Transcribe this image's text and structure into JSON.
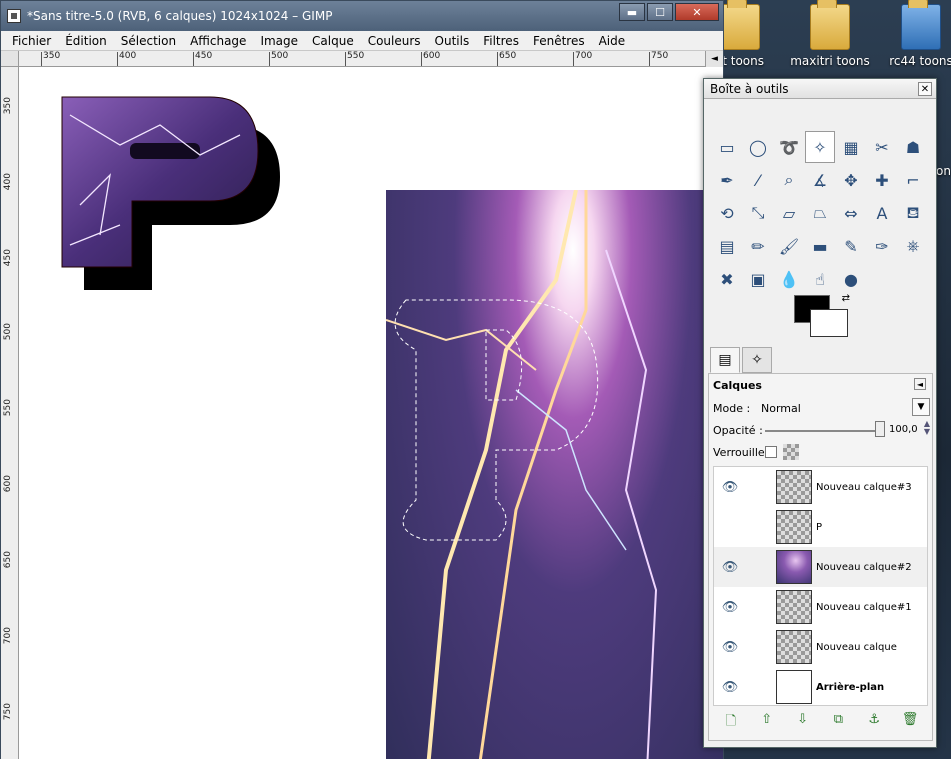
{
  "window": {
    "title": "*Sans titre-5.0 (RVB, 6 calques) 1024x1024 – GIMP",
    "minimize": "▬",
    "maximize": "☐",
    "close": "✕"
  },
  "menu": [
    "Fichier",
    "Édition",
    "Sélection",
    "Affichage",
    "Image",
    "Calque",
    "Couleurs",
    "Outils",
    "Filtres",
    "Fenêtres",
    "Aide"
  ],
  "ruler_top": [
    "350",
    "400",
    "450",
    "500",
    "550",
    "600",
    "650",
    "700",
    "750"
  ],
  "ruler_left": [
    "350",
    "400",
    "450",
    "500",
    "550",
    "600",
    "650",
    "700",
    "750"
  ],
  "desktop_icons": [
    {
      "label": "st toons",
      "color": "yellow"
    },
    {
      "label": "maxitri toons",
      "color": "yellow"
    },
    {
      "label": "rc44 toons",
      "color": "blue"
    }
  ],
  "desktop_extra": "on",
  "toolbox": {
    "title": "Boîte à outils",
    "close": "✕",
    "tools": [
      {
        "name": "rect-select-icon",
        "glyph": "▭"
      },
      {
        "name": "ellipse-select-icon",
        "glyph": "◯"
      },
      {
        "name": "lasso-icon",
        "glyph": "➰"
      },
      {
        "name": "fuzzy-select-icon",
        "glyph": "✧"
      },
      {
        "name": "color-select-icon",
        "glyph": "▦"
      },
      {
        "name": "scissors-icon",
        "glyph": "✂"
      },
      {
        "name": "foreground-select-icon",
        "glyph": "☗"
      },
      {
        "name": "paths-icon",
        "glyph": "✒"
      },
      {
        "name": "color-picker-icon",
        "glyph": "⁄"
      },
      {
        "name": "zoom-icon",
        "glyph": "⌕"
      },
      {
        "name": "measure-icon",
        "glyph": "∡"
      },
      {
        "name": "move-icon",
        "glyph": "✥"
      },
      {
        "name": "align-icon",
        "glyph": "✚"
      },
      {
        "name": "crop-icon",
        "glyph": "⌐"
      },
      {
        "name": "rotate-icon",
        "glyph": "⟲"
      },
      {
        "name": "scale-icon",
        "glyph": "⤡"
      },
      {
        "name": "shear-icon",
        "glyph": "▱"
      },
      {
        "name": "perspective-icon",
        "glyph": "⏢"
      },
      {
        "name": "flip-icon",
        "glyph": "⇔"
      },
      {
        "name": "text-icon",
        "glyph": "A"
      },
      {
        "name": "bucket-fill-icon",
        "glyph": "⛾"
      },
      {
        "name": "blend-icon",
        "glyph": "▤"
      },
      {
        "name": "pencil-icon",
        "glyph": "✏"
      },
      {
        "name": "paintbrush-icon",
        "glyph": "🖌"
      },
      {
        "name": "eraser-icon",
        "glyph": "▬"
      },
      {
        "name": "airbrush-icon",
        "glyph": "✎"
      },
      {
        "name": "ink-icon",
        "glyph": "✑"
      },
      {
        "name": "clone-icon",
        "glyph": "⎈"
      },
      {
        "name": "heal-icon",
        "glyph": "✖"
      },
      {
        "name": "perspective-clone-icon",
        "glyph": "▣"
      },
      {
        "name": "blur-icon",
        "glyph": "💧"
      },
      {
        "name": "smudge-icon",
        "glyph": "☝"
      },
      {
        "name": "dodge-burn-icon",
        "glyph": "●"
      }
    ],
    "fg_color": "#000000",
    "bg_color": "#ffffff"
  },
  "layers_panel": {
    "title": "Calques",
    "mode_label": "Mode :",
    "mode_value": "Normal",
    "opacity_label": "Opacité :",
    "opacity_value": "100,0",
    "lock_label": "Verrouiller :",
    "layers": [
      {
        "name": "Nouveau calque#3",
        "visible": true,
        "thumb": "checker",
        "bold": false
      },
      {
        "name": "P",
        "visible": false,
        "thumb": "checker",
        "bold": false
      },
      {
        "name": "Nouveau calque#2",
        "visible": true,
        "thumb": "purple",
        "bold": false,
        "selected": true
      },
      {
        "name": "Nouveau calque#1",
        "visible": true,
        "thumb": "checker",
        "bold": false
      },
      {
        "name": "Nouveau calque",
        "visible": true,
        "thumb": "checker",
        "bold": false
      },
      {
        "name": "Arrière-plan",
        "visible": true,
        "thumb": "white",
        "bold": true
      }
    ],
    "buttons": [
      "new-layer-icon",
      "raise-layer-icon",
      "lower-layer-icon",
      "duplicate-layer-icon",
      "anchor-layer-icon",
      "delete-layer-icon"
    ]
  }
}
